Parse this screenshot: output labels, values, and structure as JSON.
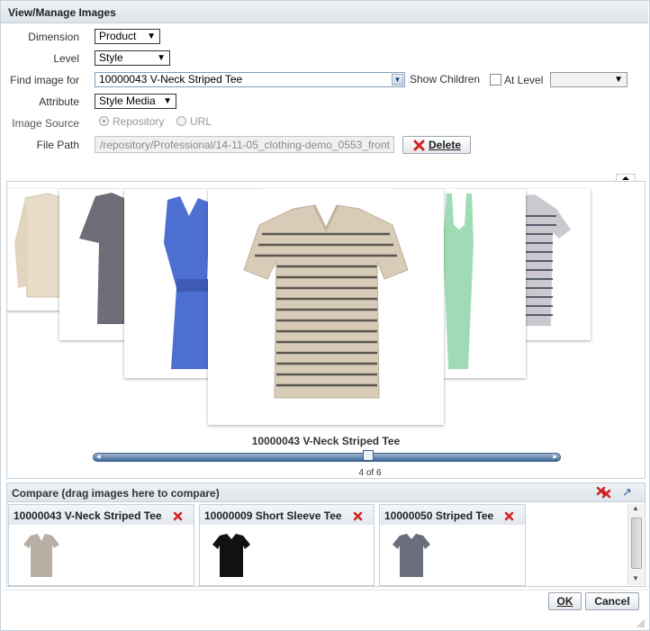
{
  "dialog": {
    "title": "View/Manage Images"
  },
  "form": {
    "dimension": {
      "label": "Dimension",
      "value": "Product"
    },
    "level": {
      "label": "Level",
      "value": "Style"
    },
    "find_image": {
      "label": "Find image for",
      "value": "10000043 V-Neck Striped Tee"
    },
    "show_children": {
      "label": "Show Children"
    },
    "at_level": {
      "label": "At Level"
    },
    "attribute": {
      "label": "Attribute",
      "value": "Style Media"
    },
    "image_source": {
      "label": "Image Source",
      "options": [
        "Repository",
        "URL"
      ],
      "selected": "Repository"
    },
    "file_path": {
      "label": "File Path",
      "value": "/repository/Professional/14-11-05_clothing-demo_0553_front"
    },
    "delete_label": "Delete"
  },
  "carousel": {
    "caption": "10000043 V-Neck Striped Tee",
    "position": "4 of 6",
    "current_index": 4,
    "total": 6
  },
  "compare": {
    "title": "Compare (drag images here to compare)",
    "items": [
      {
        "label": "10000043 V-Neck Striped Tee"
      },
      {
        "label": "10000009 Short Sleeve Tee"
      },
      {
        "label": "10000050 Striped Tee"
      }
    ]
  },
  "buttons": {
    "ok": "OK",
    "cancel": "Cancel"
  },
  "colors": {
    "accent": "#3c5f86",
    "delete_red": "#d22222",
    "header_bg": "#dde4ea"
  }
}
